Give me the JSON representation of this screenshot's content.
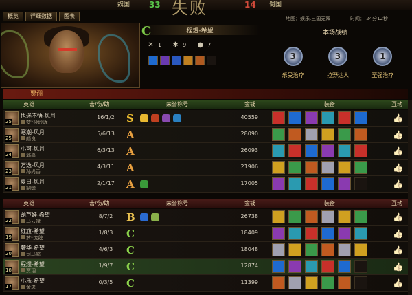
{
  "tabs": [
    {
      "label": "概览"
    },
    {
      "label": "详细数据"
    },
    {
      "label": "图表"
    }
  ],
  "scoreboard": {
    "left_team": "魏国",
    "left_score": "33",
    "right_team": "蜀国",
    "right_score": "14",
    "logo_text": "失败"
  },
  "meta": {
    "map": "地图：娱乐.三国无双",
    "time": "时间：  24分12秒"
  },
  "hero": {
    "rank": "C",
    "name": "程煜-希望",
    "kills": "1",
    "deaths": "9",
    "assists": "7"
  },
  "performance": {
    "title": "本场战绩",
    "badges": [
      {
        "num": "3",
        "label": "乐受治疗"
      },
      {
        "num": "3",
        "label": "拉野达人"
      },
      {
        "num": "1",
        "label": "至强治疗"
      }
    ]
  },
  "section": "贾诩",
  "headers": {
    "hero": "英雄",
    "kda": "击/伤/助",
    "honor": "荣誉称号",
    "gold": "金钱",
    "equip": "装备",
    "interact": "互动"
  },
  "team_green": [
    {
      "name": "执迷不悟-风月",
      "lvl": "25",
      "account": "梦*孙玲珑",
      "kda": "16/1/2",
      "rank": "S",
      "gold": "40559"
    },
    {
      "name": "寒潮-风月",
      "lvl": "25",
      "account": "颜良",
      "kda": "5/6/13",
      "rank": "A",
      "gold": "28090"
    },
    {
      "name": "小可-风月",
      "lvl": "24",
      "account": "郭嘉",
      "kda": "6/3/13",
      "rank": "A",
      "gold": "26093"
    },
    {
      "name": "万逸-风月",
      "lvl": "23",
      "account": "孙尚香",
      "kda": "4/3/11",
      "rank": "A",
      "gold": "21906"
    },
    {
      "name": "夏日-风月",
      "lvl": "21",
      "account": "貂蝉",
      "kda": "2/1/17",
      "rank": "A",
      "gold": "17005"
    }
  ],
  "team_red": [
    {
      "name": "葫芦娃-希望",
      "lvl": "22",
      "account": "马云禄",
      "kda": "8/7/2",
      "rank": "B",
      "gold": "26738"
    },
    {
      "name": "红旗-希望",
      "lvl": "19",
      "account": "梦*庞统",
      "kda": "1/8/3",
      "rank": "C",
      "gold": "18409"
    },
    {
      "name": "奢华-希望",
      "lvl": "20",
      "account": "司马懿",
      "kda": "4/6/3",
      "rank": "C",
      "gold": "18048"
    },
    {
      "name": "程煜-希望",
      "lvl": "18",
      "account": "贾诩",
      "kda": "1/9/7",
      "rank": "C",
      "gold": "12874"
    },
    {
      "name": "小乐-希望",
      "lvl": "17",
      "account": "黄忠",
      "kda": "0/3/5",
      "rank": "C",
      "gold": "11399"
    }
  ],
  "colors": {
    "green": "#59c64a",
    "red": "#d14a3a",
    "gold_text": "#e8d6b0"
  }
}
